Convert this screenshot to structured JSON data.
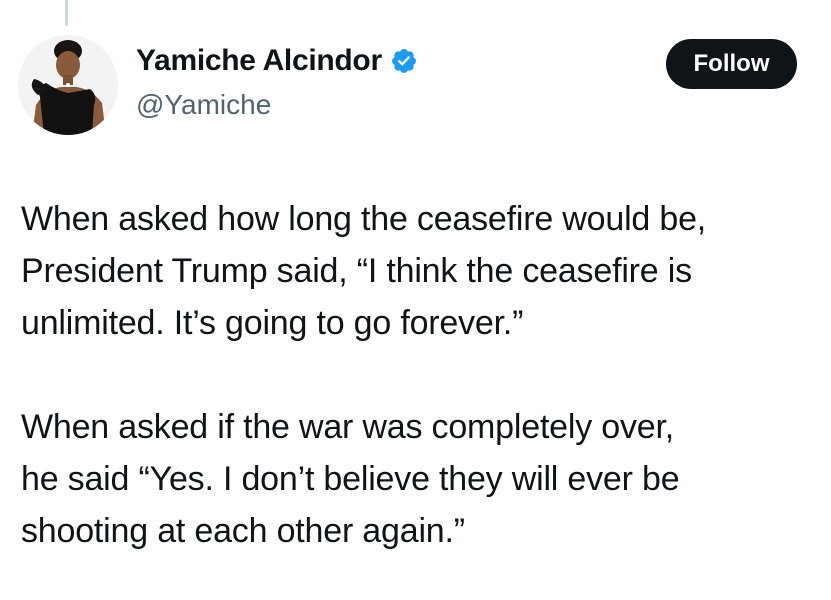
{
  "author": {
    "display_name": "Yamiche Alcindor",
    "handle": "@Yamiche",
    "verified": true,
    "avatar": "profile-photo"
  },
  "actions": {
    "follow_label": "Follow"
  },
  "tweet": {
    "paragraphs": [
      {
        "lines": [
          "When asked how long the ceasefire would be,",
          "President Trump said, “I think the ceasefire is",
          "unlimited. It’s going to go forever.”"
        ]
      },
      {
        "lines": [
          "When asked if the war was completely over,",
          "he said “Yes. I don’t believe they will ever be",
          "shooting at each other again.”"
        ]
      }
    ]
  },
  "colors": {
    "text": "#0f1419",
    "secondary_text": "#536471",
    "verified_badge": "#1d9bf0",
    "follow_button_bg": "#0f1419",
    "follow_button_text": "#ffffff",
    "thread_line": "#cfd9de"
  }
}
